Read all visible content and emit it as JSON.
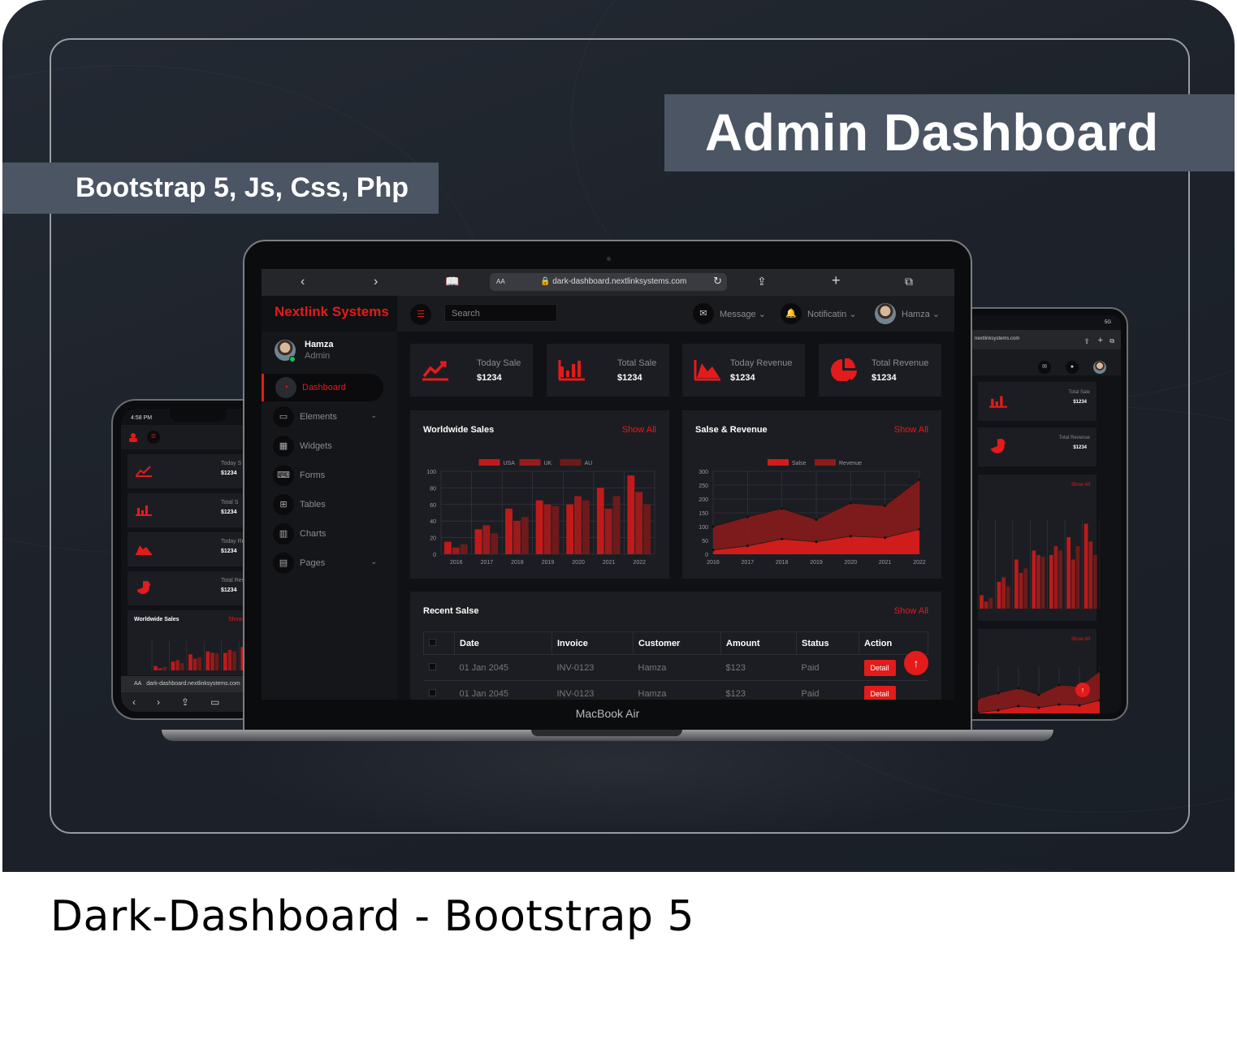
{
  "promo": {
    "title": "Admin Dashboard",
    "tech": "Bootstrap 5, Js, Css, Php",
    "caption": "Dark-Dashboard - Bootstrap 5",
    "laptop_model": "MacBook Air"
  },
  "browser": {
    "url": "dark-dashboard.nextlinksystems.com",
    "aa": "AA",
    "tablet_url": "nextlinksystems.com",
    "phone_url": "dark-dashboard.nextlinksystems.com"
  },
  "app": {
    "brand": "Nextlink Systems",
    "search_placeholder": "Search",
    "message_label": "Message",
    "notification_label": "Notificatin",
    "user_name": "Hamza",
    "user_role": "Admin"
  },
  "sidebar": {
    "items": [
      {
        "label": "Dashboard",
        "icon": "gauge-icon",
        "active": true
      },
      {
        "label": "Elements",
        "icon": "laptop-icon",
        "has_submenu": true
      },
      {
        "label": "Widgets",
        "icon": "grid-icon"
      },
      {
        "label": "Forms",
        "icon": "keyboard-icon"
      },
      {
        "label": "Tables",
        "icon": "table-icon"
      },
      {
        "label": "Charts",
        "icon": "chart-icon"
      },
      {
        "label": "Pages",
        "icon": "file-icon",
        "has_submenu": true
      }
    ]
  },
  "stats": [
    {
      "label": "Today Sale",
      "value": "$1234",
      "icon": "trend-line-icon"
    },
    {
      "label": "Total Sale",
      "value": "$1234",
      "icon": "bar-chart-icon"
    },
    {
      "label": "Today Revenue",
      "value": "$1234",
      "icon": "area-chart-icon"
    },
    {
      "label": "Total Revenue",
      "value": "$1234",
      "icon": "pie-chart-icon"
    }
  ],
  "panels": {
    "worldwide_title": "Worldwide Sales",
    "revenue_title": "Salse & Revenue",
    "recent_title": "Recent Salse",
    "show_all": "Show All"
  },
  "table": {
    "headers": [
      "Date",
      "Invoice",
      "Customer",
      "Amount",
      "Status",
      "Action"
    ],
    "rows": [
      {
        "date": "01 Jan 2045",
        "invoice": "INV-0123",
        "customer": "Hamza",
        "amount": "$123",
        "status": "Paid",
        "action": "Detail"
      },
      {
        "date": "01 Jan 2045",
        "invoice": "INV-0123",
        "customer": "Hamza",
        "amount": "$123",
        "status": "Paid",
        "action": "Detail"
      }
    ]
  },
  "phone": {
    "time": "4:58 PM",
    "stats": [
      {
        "label": "Today S",
        "value": "$1234"
      },
      {
        "label": "Total S",
        "value": "$1234"
      },
      {
        "label": "Today Reven",
        "value": "$1234"
      },
      {
        "label": "Total Reven",
        "value": "$1234"
      }
    ],
    "chart_title": "Worldwide Sales",
    "show_all": "Show"
  },
  "tablet": {
    "status": "5G",
    "stats": [
      {
        "label": "Total Sale",
        "value": "$1234"
      },
      {
        "label": "Total Revenue",
        "value": "$1234"
      }
    ],
    "show_all": "Show All"
  },
  "colors": {
    "accent": "#e31b1b",
    "usa": "#c01a1a",
    "uk": "#9a1b1b",
    "au": "#6e1a1a"
  },
  "chart_data": [
    {
      "type": "bar",
      "title": "Worldwide Sales",
      "categories": [
        "2016",
        "2017",
        "2018",
        "2019",
        "2020",
        "2021",
        "2022"
      ],
      "series": [
        {
          "name": "USA",
          "values": [
            15,
            30,
            55,
            65,
            60,
            80,
            95
          ]
        },
        {
          "name": "UK",
          "values": [
            8,
            35,
            40,
            60,
            70,
            55,
            75
          ]
        },
        {
          "name": "AU",
          "values": [
            12,
            25,
            45,
            58,
            65,
            70,
            60
          ]
        }
      ],
      "ylim": [
        0,
        100
      ],
      "yticks": [
        0,
        20,
        40,
        60,
        80,
        100
      ],
      "legend": "top-center"
    },
    {
      "type": "area",
      "title": "Salse & Revenue",
      "categories": [
        "2016",
        "2017",
        "2018",
        "2019",
        "2020",
        "2021",
        "2022"
      ],
      "series": [
        {
          "name": "Salse",
          "values": [
            15,
            30,
            55,
            45,
            65,
            60,
            90
          ]
        },
        {
          "name": "Revenue",
          "values": [
            100,
            135,
            165,
            125,
            185,
            175,
            270
          ]
        }
      ],
      "ylim": [
        0,
        300
      ],
      "yticks": [
        0,
        50,
        100,
        150,
        200,
        250,
        300
      ],
      "legend": "top-center"
    }
  ]
}
